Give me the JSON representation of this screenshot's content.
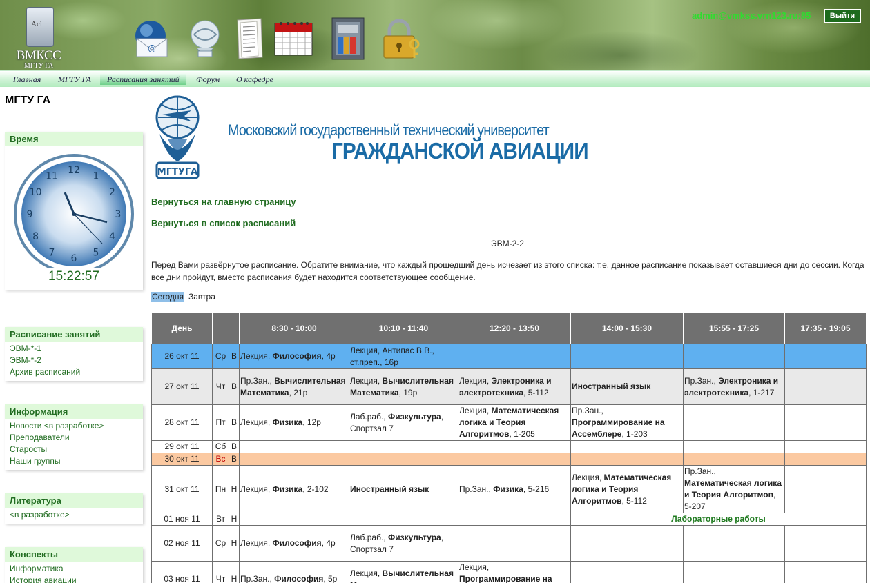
{
  "header": {
    "logo_title": "ВМКСС",
    "logo_sub": "МГТУ ГА",
    "logo_mark": "Acl",
    "user_email": "admin@vmkss.vrn123.ru:85",
    "logout_label": "Выйти",
    "icons": [
      "mail-icon",
      "emblem-icon",
      "document-icon",
      "calendar-icon",
      "safe-icon",
      "lock-icon"
    ]
  },
  "nav": {
    "items": [
      "Главная",
      "МГТУ ГА",
      "Расписания занятий",
      "Форум",
      "О кафедре"
    ],
    "active": "Расписания занятий"
  },
  "sidebar": {
    "site_title": "МГТУ ГА",
    "clock": {
      "title": "Время",
      "time": "15:22:57",
      "numerals": [
        "12",
        "1",
        "2",
        "3",
        "4",
        "5",
        "6",
        "7",
        "8",
        "9",
        "10",
        "11"
      ]
    },
    "schedule": {
      "title": "Расписание занятий",
      "items": [
        "ЭВМ-*-1",
        "ЭВМ-*-2",
        "Архив расписаний"
      ]
    },
    "info": {
      "title": "Информация",
      "items": [
        "Новости <в разработке>",
        "Преподаватели",
        "Старосты",
        "Наши группы"
      ]
    },
    "literature": {
      "title": "Литература",
      "items": [
        "<в разработке>"
      ]
    },
    "notes": {
      "title": "Конспекты",
      "items": [
        "Информатика",
        "История авиации"
      ]
    }
  },
  "main": {
    "banner_line1": "Московский государственный технический университет",
    "banner_line2": "ГРАЖДАНСКОЙ АВИАЦИИ",
    "emblem_text": "МГТУГА",
    "back_home": "Вернуться на главную страницу",
    "back_list": "Вернуться в список расписаний",
    "group": "ЭВМ-2-2",
    "notice": "Перед Вами развёрнутое расписание. Обратите внимание, что каждый прошедший день исчезает из этого списка: т.е. данное расписание показывает оставшиеся дни до сессии. Когда все дни пройдут, вместо расписания будет находится соответствующее сообщение.",
    "filter_today": "Сегодня",
    "filter_tomorrow": "Завтра"
  },
  "schedule": {
    "headers": [
      "День",
      "",
      "",
      "8:30 - 10:00",
      "10:10 - 11:40",
      "12:20 - 13:50",
      "14:00 - 15:30",
      "15:55 - 17:25",
      "17:35 - 19:05"
    ],
    "rows": [
      {
        "date": "26 окт 11",
        "dow": "Ср",
        "week": "В",
        "style": "today",
        "cells": [
          [
            [
              "",
              "Лекция, "
            ],
            [
              "b",
              "Философия"
            ],
            [
              "",
              ", 4р"
            ]
          ],
          [
            [
              "",
              "Лекция, Антипас В.В., ст.преп.,     16р"
            ]
          ],
          [],
          [],
          [],
          []
        ]
      },
      {
        "date": "27 окт 11",
        "dow": "Чт",
        "week": "В",
        "style": "gray",
        "cells": [
          [
            [
              "",
              "Пр.Зан., "
            ],
            [
              "b",
              "Вычислительная Математика"
            ],
            [
              "",
              ",     21р"
            ]
          ],
          [
            [
              "",
              "Лекция, "
            ],
            [
              "b",
              "Вычислительная Математика"
            ],
            [
              "",
              ",     19р"
            ]
          ],
          [
            [
              "",
              "Лекция, "
            ],
            [
              "b",
              "Электроника и электротехника"
            ],
            [
              "",
              ",     5-112"
            ]
          ],
          [
            [
              "b",
              "Иностранный язык"
            ]
          ],
          [
            [
              "",
              "Пр.Зан., "
            ],
            [
              "b",
              "Электроника и электротехника"
            ],
            [
              "",
              ", 1-217"
            ]
          ],
          []
        ]
      },
      {
        "date": "28 окт 11",
        "dow": "Пт",
        "week": "В",
        "style": "",
        "cells": [
          [
            [
              "",
              "Лекция, "
            ],
            [
              "b",
              "Физика"
            ],
            [
              "",
              ",     12р"
            ]
          ],
          [
            [
              "",
              "Лаб.раб., "
            ],
            [
              "b",
              "Физкультура"
            ],
            [
              "",
              ", Спортзал 7"
            ]
          ],
          [
            [
              "",
              "Лекция, "
            ],
            [
              "b",
              "Математическая логика и Теория Алгоритмов"
            ],
            [
              "",
              ",     1-205"
            ]
          ],
          [
            [
              "",
              "Пр.Зан., "
            ],
            [
              "b",
              "Программирование на Ассемблере"
            ],
            [
              "",
              ",     1-203"
            ]
          ],
          [],
          []
        ]
      },
      {
        "date": "29 окт 11",
        "dow": "Сб",
        "week": "В",
        "style": "",
        "cells": [
          [],
          [],
          [],
          [],
          [],
          []
        ]
      },
      {
        "date": "30 окт 11",
        "dow": "Вс",
        "week": "В",
        "style": "sunday",
        "cells": [
          [],
          [],
          [],
          [],
          [],
          []
        ]
      },
      {
        "date": "31 окт 11",
        "dow": "Пн",
        "week": "Н",
        "style": "",
        "cells": [
          [
            [
              "",
              "Лекция, "
            ],
            [
              "b",
              "Физика"
            ],
            [
              "",
              ",     2-102"
            ]
          ],
          [
            [
              "b",
              "Иностранный язык"
            ]
          ],
          [
            [
              "",
              "Пр.Зан., "
            ],
            [
              "b",
              "Физика"
            ],
            [
              "",
              ",     5-216"
            ]
          ],
          [
            [
              "",
              "Лекция, "
            ],
            [
              "b",
              "Математическая логика и Теория Алгоритмов"
            ],
            [
              "",
              ",     5-112"
            ]
          ],
          [
            [
              "",
              "Пр.Зан., "
            ],
            [
              "b",
              "Математическая логика и Теория Алгоритмов"
            ],
            [
              "",
              ",     5-207"
            ]
          ],
          []
        ]
      },
      {
        "date": "01 ноя 11",
        "dow": "Вт",
        "week": "Н",
        "style": "",
        "lab_note": "Лабораторные работы",
        "cells": []
      },
      {
        "date": "02 ноя 11",
        "dow": "Ср",
        "week": "Н",
        "style": "",
        "cells": [
          [
            [
              "",
              "Лекция, "
            ],
            [
              "b",
              "Философия"
            ],
            [
              "",
              ", 4р"
            ]
          ],
          [
            [
              "",
              "Лаб.раб., "
            ],
            [
              "b",
              "Физкультура"
            ],
            [
              "",
              ", Спортзал 7"
            ]
          ],
          [],
          [],
          [],
          []
        ]
      },
      {
        "date": "03 ноя 11",
        "dow": "Чт",
        "week": "Н",
        "style": "",
        "cells": [
          [
            [
              "",
              "Пр.Зан., "
            ],
            [
              "b",
              "Философия"
            ],
            [
              "",
              ", 5р"
            ]
          ],
          [
            [
              "",
              "Лекция, "
            ],
            [
              "b",
              "Вычислительная Математика"
            ]
          ],
          [
            [
              "",
              "Лекция, "
            ],
            [
              "b",
              "Программирование на Ассемблере"
            ]
          ],
          [],
          [],
          []
        ]
      }
    ]
  }
}
